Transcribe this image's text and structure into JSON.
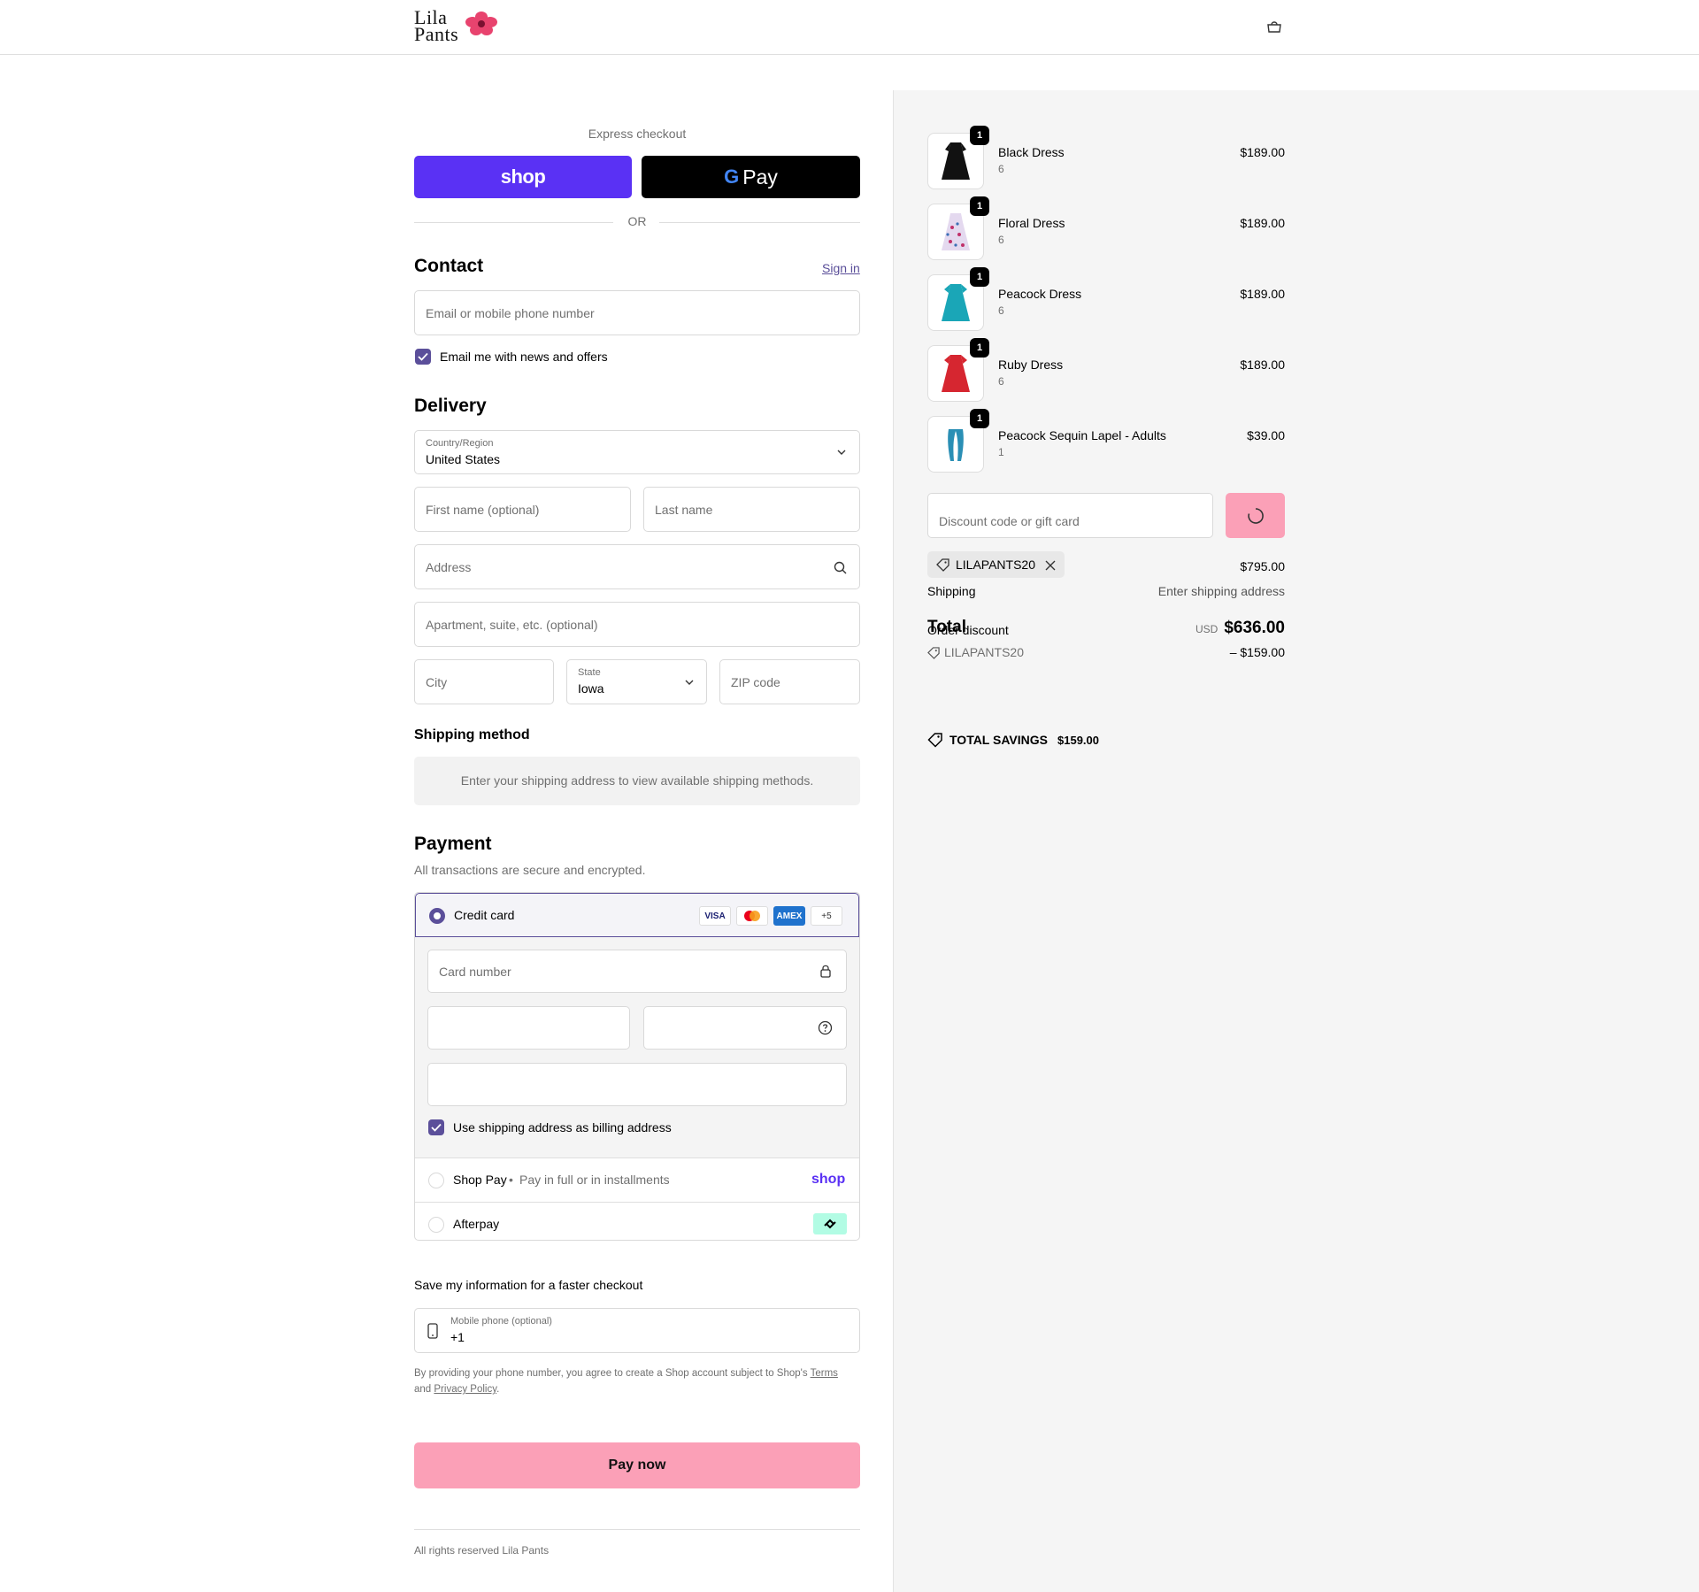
{
  "brand": {
    "line1": "Lila",
    "line2": "Pants"
  },
  "express": {
    "title": "Express checkout",
    "shop_label": "shop",
    "gpay_g": "G",
    "gpay_label": "Pay",
    "or": "OR"
  },
  "contact": {
    "title": "Contact",
    "sign_in": "Sign in",
    "email_placeholder": "Email or mobile phone number",
    "news_label": "Email me with news and offers",
    "news_checked": true
  },
  "delivery": {
    "title": "Delivery",
    "country_label": "Country/Region",
    "country_value": "United States",
    "first_name_placeholder": "First name (optional)",
    "last_name_placeholder": "Last name",
    "address_placeholder": "Address",
    "apartment_placeholder": "Apartment, suite, etc. (optional)",
    "city_placeholder": "City",
    "state_label": "State",
    "state_value": "Iowa",
    "zip_placeholder": "ZIP code"
  },
  "shipping_method": {
    "title": "Shipping method",
    "message": "Enter your shipping address to view available shipping methods."
  },
  "payment": {
    "title": "Payment",
    "subtitle": "All transactions are secure and encrypted.",
    "credit_card_label": "Credit card",
    "cards": [
      "VISA",
      "MC",
      "AMEX",
      "+5"
    ],
    "card_number_placeholder": "Card number",
    "billing_label": "Use shipping address as billing address",
    "billing_checked": true,
    "shop_pay_label": "Shop Pay",
    "shop_pay_sub": "Pay in full or in installments",
    "shop_pay_logo": "shop",
    "afterpay_label": "Afterpay"
  },
  "save_info": {
    "title": "Save my information for a faster checkout",
    "phone_label": "Mobile phone (optional)",
    "phone_value": "+1",
    "terms_prefix": "By providing your phone number, you agree to create a Shop account subject to Shop's",
    "terms_link": "Terms",
    "terms_and": "and",
    "privacy_link": "Privacy Policy",
    "terms_end": "."
  },
  "pay_now": "Pay now",
  "footer": "All rights reserved Lila Pants",
  "order": {
    "items": [
      {
        "name": "Black Dress",
        "variant": "6",
        "price": "$189.00",
        "qty": "1",
        "color": "#111111"
      },
      {
        "name": "Floral Dress",
        "variant": "6",
        "price": "$189.00",
        "qty": "1",
        "color": "#d8c8e8"
      },
      {
        "name": "Peacock Dress",
        "variant": "6",
        "price": "$189.00",
        "qty": "1",
        "color": "#1aa6b7"
      },
      {
        "name": "Ruby Dress",
        "variant": "6",
        "price": "$189.00",
        "qty": "1",
        "color": "#d62630"
      },
      {
        "name": "Peacock Sequin Lapel - Adults",
        "variant": "1",
        "price": "$39.00",
        "qty": "1",
        "color": "#2a8fb5"
      }
    ],
    "discount_placeholder": "Discount code or gift card",
    "applied_code": "LILAPANTS20",
    "subtotal_value": "$795.00",
    "shipping_label": "Shipping",
    "shipping_value": "Enter shipping address",
    "order_discount_label": "Order discount",
    "total_label": "Total",
    "total_currency": "USD",
    "total_value": "$636.00",
    "discount_code": "LILAPANTS20",
    "discount_value": "– $159.00",
    "savings_label": "TOTAL SAVINGS",
    "savings_value": "$159.00"
  },
  "colors": {
    "accent": "#5b4f9a",
    "shop": "#5a31f4",
    "pink": "#fba0b7"
  }
}
